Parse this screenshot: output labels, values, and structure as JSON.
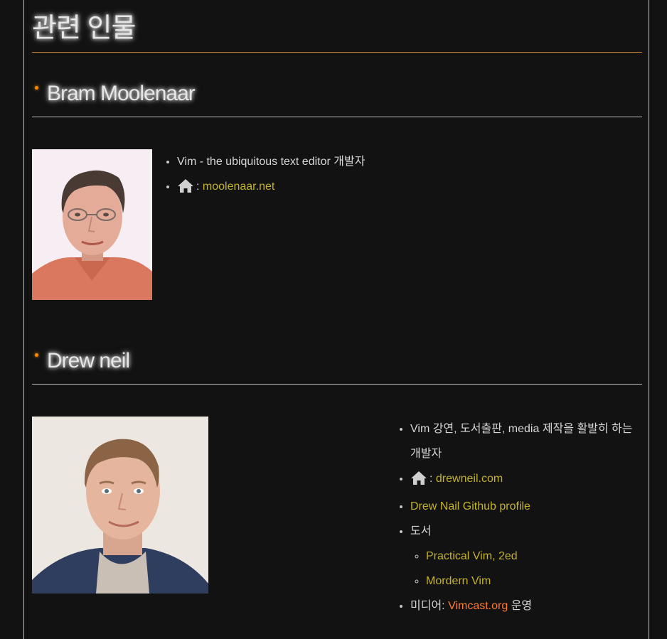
{
  "page": {
    "title": "관련 인물"
  },
  "people": [
    {
      "name": "Bram Moolenaar",
      "items": [
        {
          "text": "Vim - the ubiquitous text editor 개발자"
        },
        {
          "icon": "home-icon",
          "prefix": ":",
          "link": "moolenaar.net"
        }
      ]
    },
    {
      "name": "Drew neil",
      "items": [
        {
          "text": "Vim 강연, 도서출판, media 제작을 활발히 하는 개발자"
        },
        {
          "icon": "home-icon",
          "prefix": ":",
          "link": "drewneil.com"
        },
        {
          "link": "Drew Nail Github profile"
        },
        {
          "text": "도서",
          "books": [
            "Practical Vim, 2ed",
            "Mordern Vim"
          ]
        },
        {
          "text_before": "미디어: ",
          "link": "Vimcast.org",
          "text_after": " 운영"
        }
      ]
    }
  ],
  "colors": {
    "link": "#c3b22a",
    "link_alt": "#ff7a2a",
    "accent": "#ff8a00",
    "background": "#121212"
  }
}
